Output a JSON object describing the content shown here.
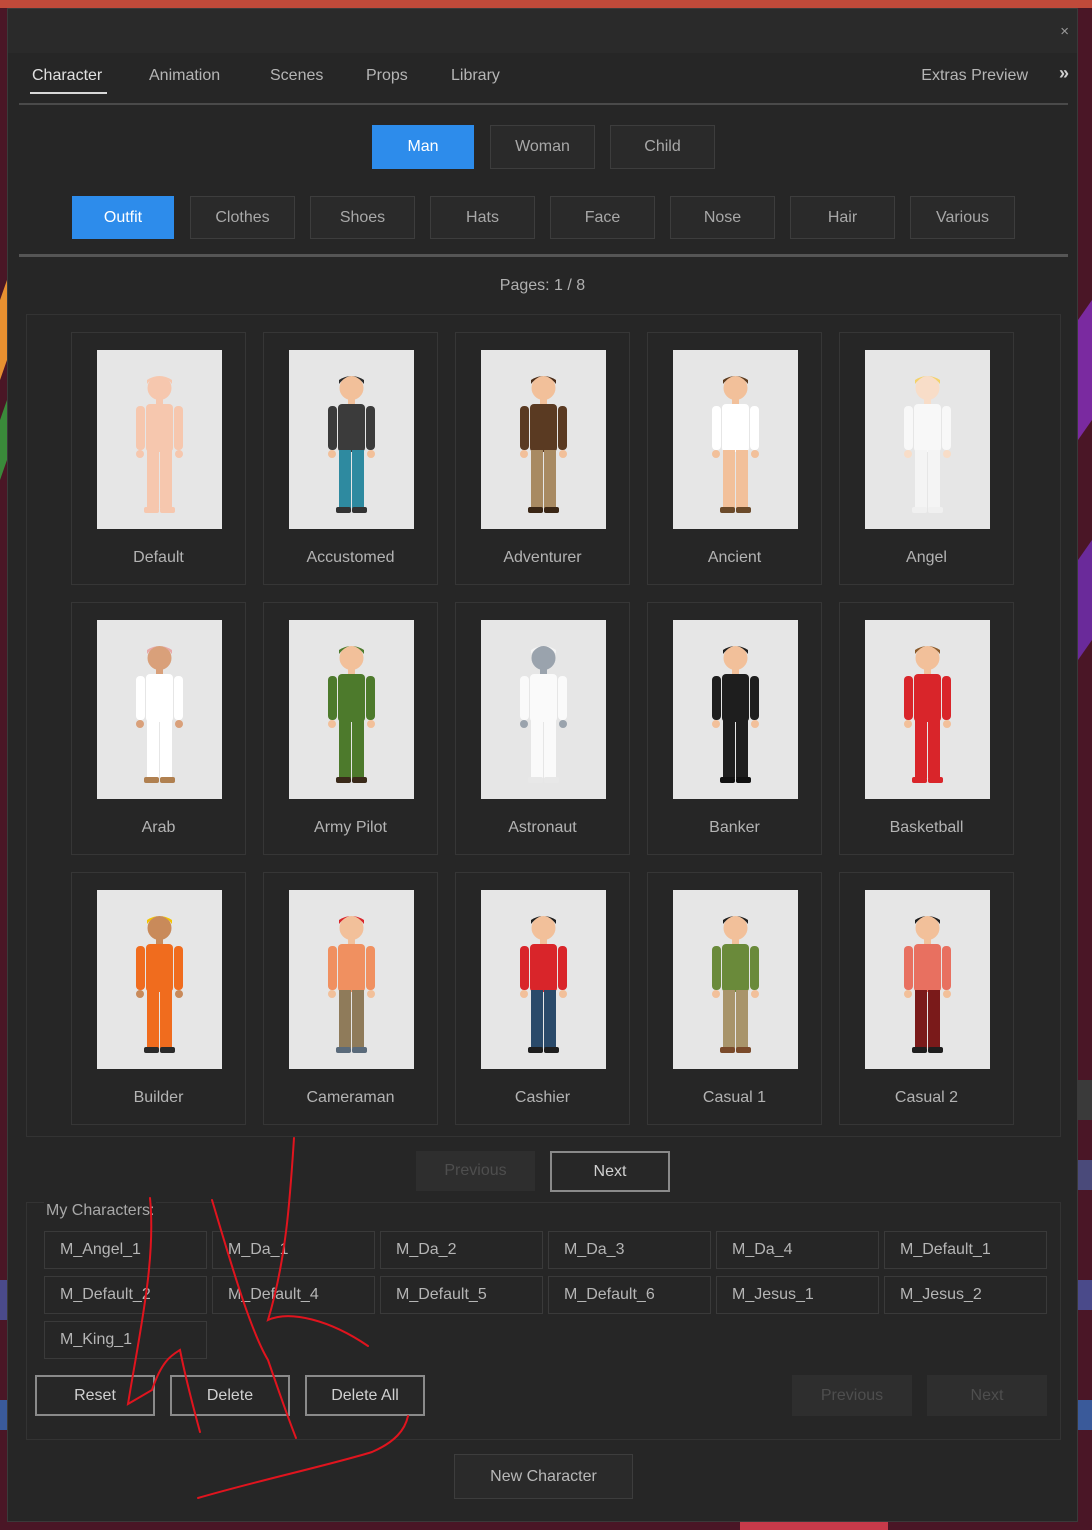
{
  "window": {
    "close_glyph": "×"
  },
  "tabs": [
    {
      "label": "Character",
      "active": true
    },
    {
      "label": "Animation",
      "active": false
    },
    {
      "label": "Scenes",
      "active": false
    },
    {
      "label": "Props",
      "active": false
    },
    {
      "label": "Library",
      "active": false
    }
  ],
  "extras_label": "Extras Preview",
  "expand_glyph": "»",
  "gender_buttons": [
    {
      "label": "Man",
      "active": true
    },
    {
      "label": "Woman",
      "active": false
    },
    {
      "label": "Child",
      "active": false
    }
  ],
  "category_buttons": [
    {
      "label": "Outfit",
      "active": true
    },
    {
      "label": "Clothes",
      "active": false
    },
    {
      "label": "Shoes",
      "active": false
    },
    {
      "label": "Hats",
      "active": false
    },
    {
      "label": "Face",
      "active": false
    },
    {
      "label": "Nose",
      "active": false
    },
    {
      "label": "Hair",
      "active": false
    },
    {
      "label": "Various",
      "active": false
    }
  ],
  "pages_text": "Pages: 1 / 8",
  "outfits": [
    {
      "label": "Default",
      "skin": "#f6c7ae",
      "top": "#f6c7ae",
      "pants": "#f6c7ae",
      "hair": "#f6c7ae",
      "shoes": "#f6c7ae"
    },
    {
      "label": "Accustomed",
      "skin": "#f2c09a",
      "top": "#3b3b3b",
      "pants": "#2e8aa0",
      "hair": "#2a2a2a",
      "shoes": "#333333"
    },
    {
      "label": "Adventurer",
      "skin": "#f2c09a",
      "top": "#5a3a22",
      "pants": "#a88a62",
      "hair": "#4a2c18",
      "shoes": "#3a2615"
    },
    {
      "label": "Ancient",
      "skin": "#f2c09a",
      "top": "#ffffff",
      "pants": "#f2c09a",
      "hair": "#5a3a1e",
      "shoes": "#6b4a2a"
    },
    {
      "label": "Angel",
      "skin": "#f8ddc8",
      "top": "#f8f8f8",
      "pants": "#f4f4f4",
      "hair": "#f4d26a",
      "shoes": "#f0f0f0"
    },
    {
      "label": "Arab",
      "skin": "#d9a07a",
      "top": "#ffffff",
      "pants": "#ffffff",
      "hair": "#e8a8a8",
      "shoes": "#b08050"
    },
    {
      "label": "Army Pilot",
      "skin": "#f2c09a",
      "top": "#4d7a2c",
      "pants": "#4d7a2c",
      "hair": "#4d7a2c",
      "shoes": "#3a2a1a"
    },
    {
      "label": "Astronaut",
      "skin": "#9aa3ad",
      "top": "#fafafa",
      "pants": "#fafafa",
      "hair": "#f4f4f4",
      "shoes": "#e8e8e8"
    },
    {
      "label": "Banker",
      "skin": "#f2c09a",
      "top": "#1e1e1e",
      "pants": "#1e1e1e",
      "hair": "#1e1e1e",
      "shoes": "#111111"
    },
    {
      "label": "Basketball",
      "skin": "#f2c09a",
      "top": "#d9252a",
      "pants": "#d9252a",
      "hair": "#8a5a2a",
      "shoes": "#d9252a"
    },
    {
      "label": "Builder",
      "skin": "#c98a5a",
      "top": "#f06c1e",
      "pants": "#f06c1e",
      "hair": "#f4c400",
      "shoes": "#2a2a2a"
    },
    {
      "label": "Cameraman",
      "skin": "#f2c09a",
      "top": "#f09060",
      "pants": "#8f7b5a",
      "hair": "#d9252a",
      "shoes": "#5a6a7a"
    },
    {
      "label": "Cashier",
      "skin": "#f2c09a",
      "top": "#d9252a",
      "pants": "#2a4a6a",
      "hair": "#1e1e1e",
      "shoes": "#1e1e1e"
    },
    {
      "label": "Casual 1",
      "skin": "#f2c09a",
      "top": "#6a8a3a",
      "pants": "#a8946a",
      "hair": "#1e1e1e",
      "shoes": "#7a4a2a"
    },
    {
      "label": "Casual 2",
      "skin": "#f2c09a",
      "top": "#e87060",
      "pants": "#7a1a1a",
      "hair": "#1e1e1e",
      "shoes": "#1e1e1e"
    }
  ],
  "grid_previous": "Previous",
  "grid_next": "Next",
  "my_characters_label": "My Characters:",
  "my_characters": [
    "M_Angel_1",
    "M_Da_1",
    "M_Da_2",
    "M_Da_3",
    "M_Da_4",
    "M_Default_1",
    "M_Default_2",
    "M_Default_4",
    "M_Default_5",
    "M_Default_6",
    "M_Jesus_1",
    "M_Jesus_2",
    "M_King_1"
  ],
  "actions": {
    "reset": "Reset",
    "delete": "Delete",
    "delete_all": "Delete All",
    "previous": "Previous",
    "next": "Next"
  },
  "new_character": "New Character",
  "accent_color": "#2d8ceb",
  "annotation_color": "#e0141e"
}
